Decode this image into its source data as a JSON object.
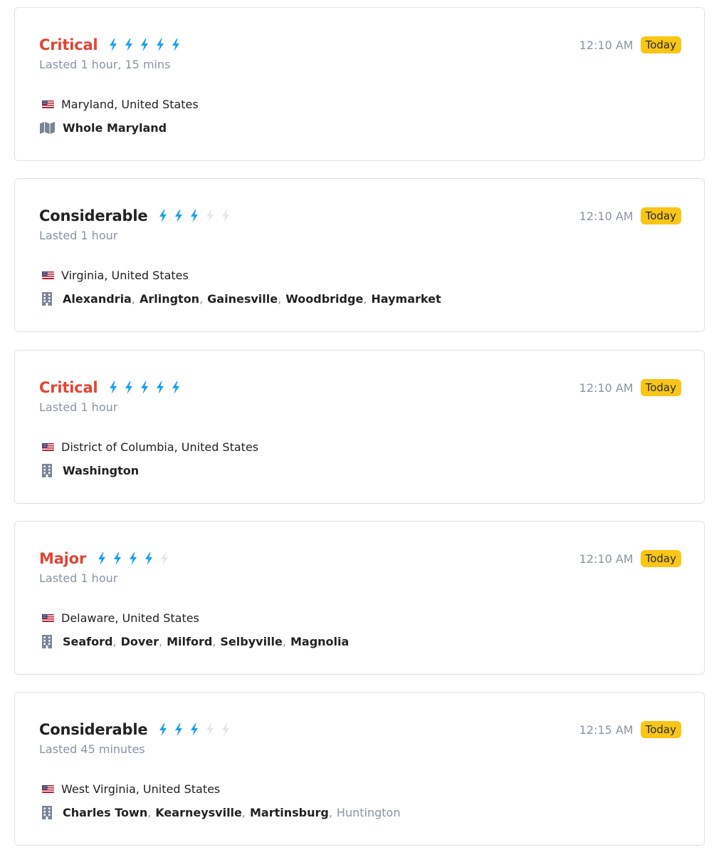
{
  "alerts": [
    {
      "severity": "Critical",
      "severity_color": "#e04535",
      "bolts_filled": 5,
      "bolts_total": 5,
      "duration": "Lasted 1 hour, 15 mins",
      "time": "12:10 AM",
      "badge": "Today",
      "flag_icon": "us-flag-icon",
      "region": "Maryland, United States",
      "places_icon": "map-icon",
      "places": [
        {
          "name": "Whole Maryland",
          "muted": false
        }
      ]
    },
    {
      "severity": "Considerable",
      "severity_color": "#222222",
      "bolts_filled": 3,
      "bolts_total": 5,
      "duration": "Lasted 1 hour",
      "time": "12:10 AM",
      "badge": "Today",
      "flag_icon": "us-flag-icon",
      "region": "Virginia, United States",
      "places_icon": "building-icon",
      "places": [
        {
          "name": "Alexandria",
          "muted": false
        },
        {
          "name": "Arlington",
          "muted": false
        },
        {
          "name": "Gainesville",
          "muted": false
        },
        {
          "name": "Woodbridge",
          "muted": false
        },
        {
          "name": "Haymarket",
          "muted": false
        }
      ]
    },
    {
      "severity": "Critical",
      "severity_color": "#e04535",
      "bolts_filled": 5,
      "bolts_total": 5,
      "duration": "Lasted 1 hour",
      "time": "12:10 AM",
      "badge": "Today",
      "flag_icon": "us-flag-icon",
      "region": "District of Columbia, United States",
      "places_icon": "building-icon",
      "places": [
        {
          "name": "Washington",
          "muted": false
        }
      ]
    },
    {
      "severity": "Major",
      "severity_color": "#e04535",
      "bolts_filled": 4,
      "bolts_total": 5,
      "duration": "Lasted 1 hour",
      "time": "12:10 AM",
      "badge": "Today",
      "flag_icon": "us-flag-icon",
      "region": "Delaware, United States",
      "places_icon": "building-icon",
      "places": [
        {
          "name": "Seaford",
          "muted": false
        },
        {
          "name": "Dover",
          "muted": false
        },
        {
          "name": "Milford",
          "muted": false
        },
        {
          "name": "Selbyville",
          "muted": false
        },
        {
          "name": "Magnolia",
          "muted": false
        }
      ]
    },
    {
      "severity": "Considerable",
      "severity_color": "#222222",
      "bolts_filled": 3,
      "bolts_total": 5,
      "duration": "Lasted 45 minutes",
      "time": "12:15 AM",
      "badge": "Today",
      "flag_icon": "us-flag-icon",
      "region": "West Virginia, United States",
      "places_icon": "building-icon",
      "places": [
        {
          "name": "Charles Town",
          "muted": false
        },
        {
          "name": "Kearneysville",
          "muted": false
        },
        {
          "name": "Martinsburg",
          "muted": false
        },
        {
          "name": "Huntington",
          "muted": true
        }
      ]
    }
  ]
}
